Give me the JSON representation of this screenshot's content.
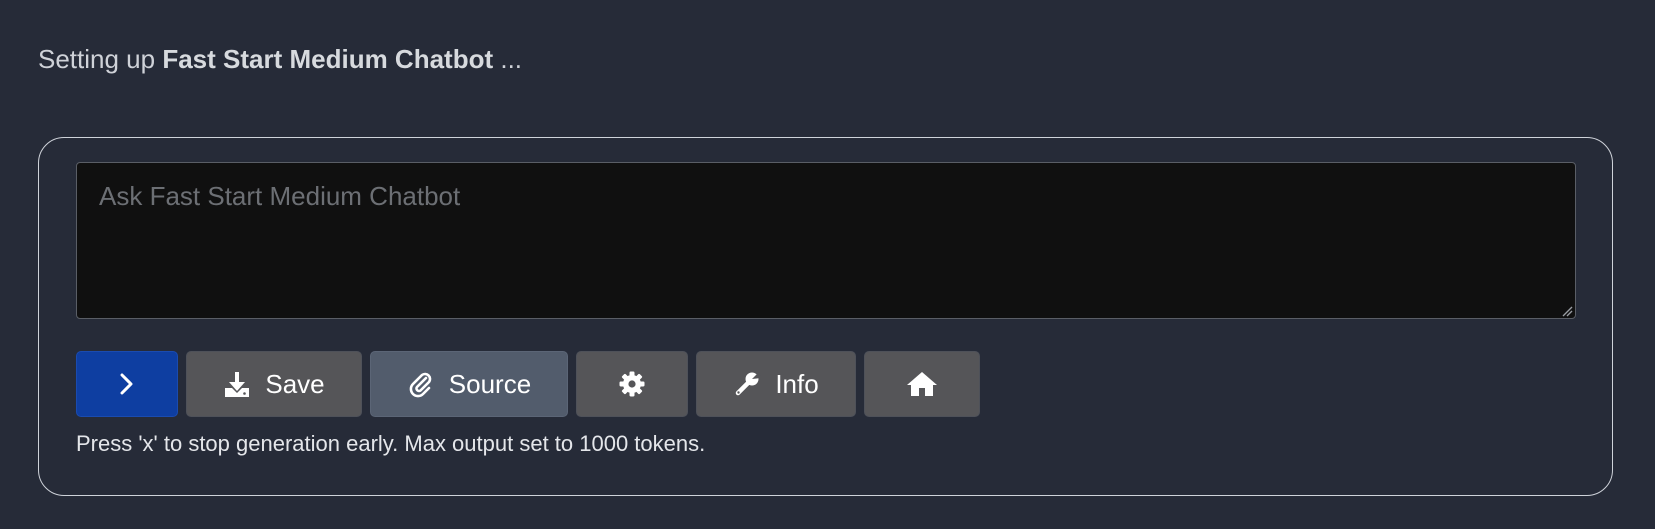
{
  "status": {
    "prefix": "Setting up",
    "bot_name": "Fast Start Medium Chatbot",
    "suffix": "..."
  },
  "prompt": {
    "placeholder": "Ask Fast Start Medium Chatbot",
    "value": ""
  },
  "toolbar": {
    "send_icon": "chevron-right-icon",
    "save_label": "Save",
    "save_icon": "download-icon",
    "source_label": "Source",
    "source_icon": "paperclip-icon",
    "settings_icon": "gear-icon",
    "info_label": "Info",
    "info_icon": "wrench-icon",
    "home_icon": "home-icon"
  },
  "hint": "Press 'x' to stop generation early. Max output set to 1000 tokens.",
  "colors": {
    "background": "#262b38",
    "send_button": "#0e3ea1",
    "source_button": "#525c6c",
    "default_button": "#555558",
    "prompt_background": "#101010"
  }
}
